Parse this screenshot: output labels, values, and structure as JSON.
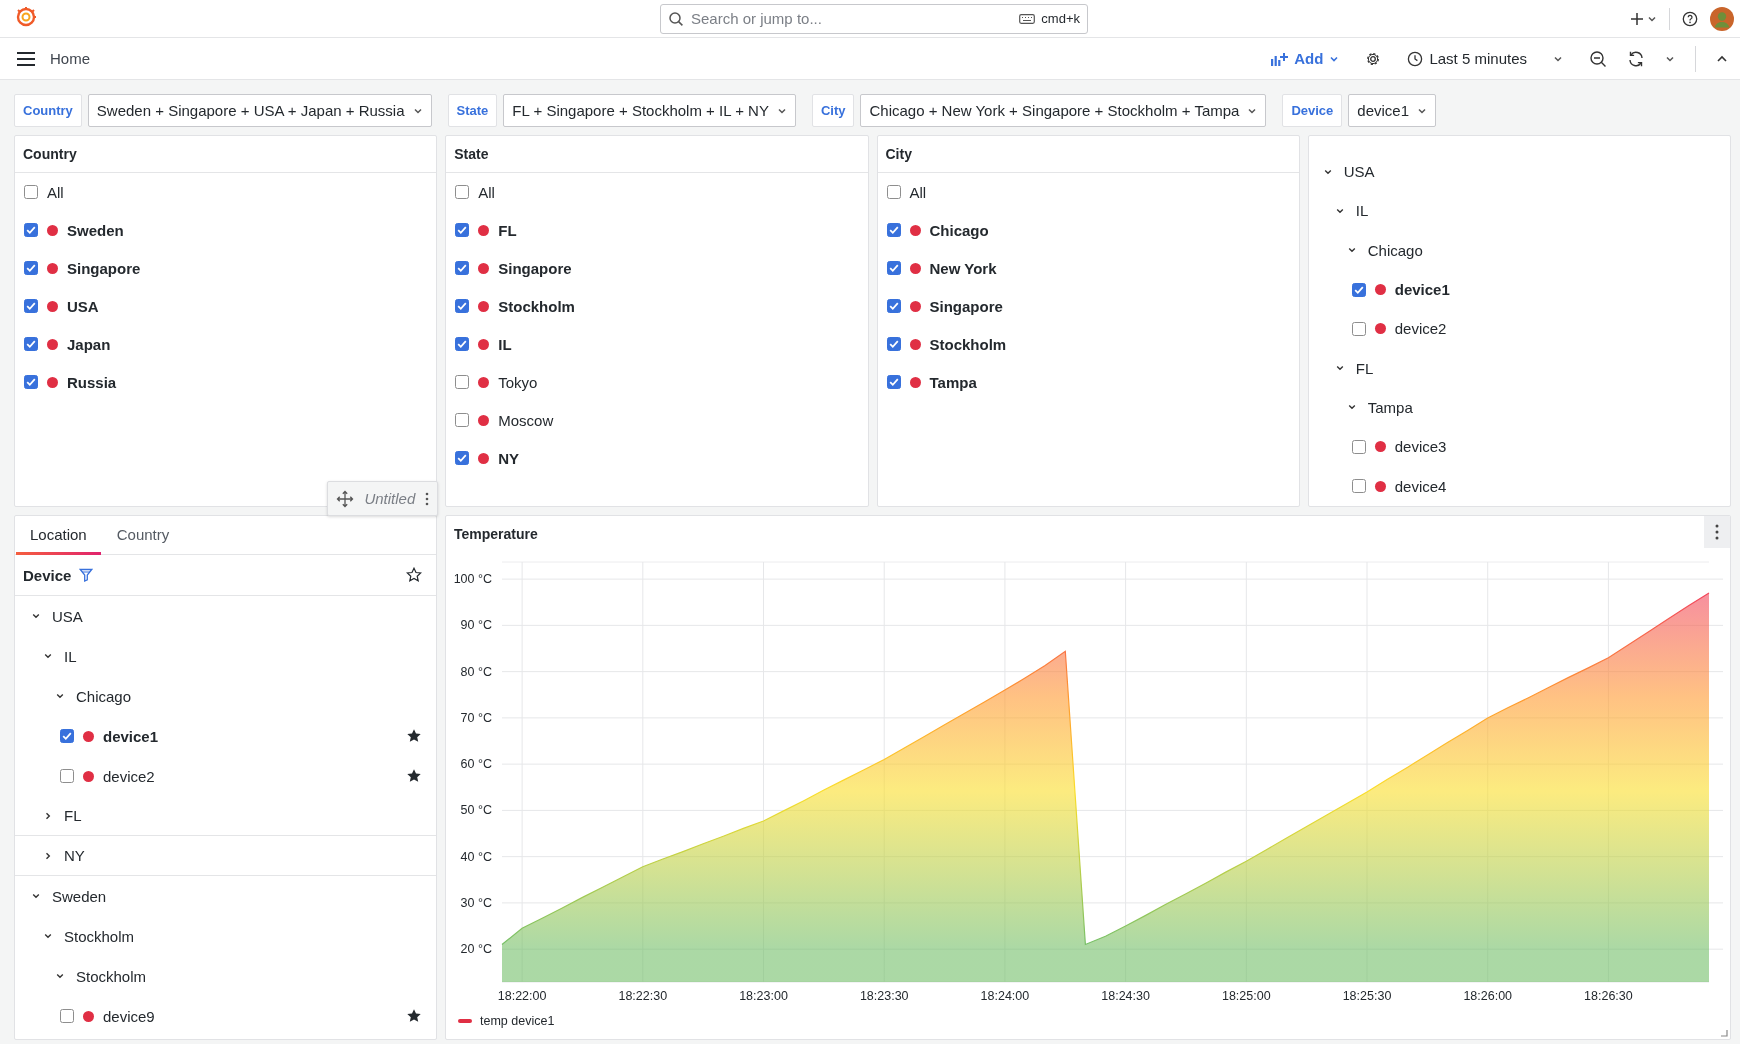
{
  "topbar": {
    "search": {
      "placeholder": "Search or jump to...",
      "shortcut": "cmd+k"
    }
  },
  "toolbar": {
    "breadcrumb": "Home",
    "add_label": "Add",
    "time_range": "Last 5 minutes"
  },
  "variables": [
    {
      "label": "Country",
      "value": "Sweden + Singapore + USA + Japan + Russia"
    },
    {
      "label": "State",
      "value": "FL + Singapore + Stockholm + IL + NY"
    },
    {
      "label": "City",
      "value": "Chicago + New York + Singapore + Stockholm + Tampa"
    },
    {
      "label": "Device",
      "value": "device1"
    }
  ],
  "option_panels": [
    {
      "title": "Country",
      "hover_header": {
        "title": "Untitled"
      },
      "options": [
        {
          "label": "All",
          "kind": "all",
          "checked": false
        },
        {
          "label": "Sweden",
          "kind": "option",
          "checked": true
        },
        {
          "label": "Singapore",
          "kind": "option",
          "checked": true
        },
        {
          "label": "USA",
          "kind": "option",
          "checked": true
        },
        {
          "label": "Japan",
          "kind": "option",
          "checked": true
        },
        {
          "label": "Russia",
          "kind": "option",
          "checked": true
        }
      ]
    },
    {
      "title": "State",
      "options": [
        {
          "label": "All",
          "kind": "all",
          "checked": false
        },
        {
          "label": "FL",
          "kind": "option",
          "checked": true
        },
        {
          "label": "Singapore",
          "kind": "option",
          "checked": true
        },
        {
          "label": "Stockholm",
          "kind": "option",
          "checked": true
        },
        {
          "label": "IL",
          "kind": "option",
          "checked": true
        },
        {
          "label": "Tokyo",
          "kind": "option",
          "checked": false
        },
        {
          "label": "Moscow",
          "kind": "option",
          "checked": false
        },
        {
          "label": "NY",
          "kind": "option",
          "checked": true
        }
      ]
    },
    {
      "title": "City",
      "options": [
        {
          "label": "All",
          "kind": "all",
          "checked": false
        },
        {
          "label": "Chicago",
          "kind": "option",
          "checked": true
        },
        {
          "label": "New York",
          "kind": "option",
          "checked": true
        },
        {
          "label": "Singapore",
          "kind": "option",
          "checked": true
        },
        {
          "label": "Stockholm",
          "kind": "option",
          "checked": true
        },
        {
          "label": "Tampa",
          "kind": "option",
          "checked": true
        }
      ]
    }
  ],
  "tree_panel": {
    "items": [
      {
        "label": "USA",
        "kind": "group",
        "expanded": true,
        "children": [
          {
            "label": "IL",
            "kind": "group",
            "expanded": true,
            "children": [
              {
                "label": "Chicago",
                "kind": "group",
                "expanded": true,
                "children": [
                  {
                    "label": "device1",
                    "kind": "device",
                    "checked": true
                  },
                  {
                    "label": "device2",
                    "kind": "device",
                    "checked": false
                  }
                ]
              }
            ]
          },
          {
            "label": "FL",
            "kind": "group",
            "expanded": true,
            "children": [
              {
                "label": "Tampa",
                "kind": "group",
                "expanded": true,
                "children": [
                  {
                    "label": "device3",
                    "kind": "device",
                    "checked": false
                  },
                  {
                    "label": "device4",
                    "kind": "device",
                    "checked": false
                  }
                ]
              }
            ]
          }
        ]
      }
    ]
  },
  "device_browser": {
    "tabs": [
      {
        "label": "Location",
        "selected": true
      },
      {
        "label": "Country",
        "selected": false
      }
    ],
    "header": {
      "title": "Device",
      "favorites_only": false
    },
    "items": [
      {
        "label": "USA",
        "kind": "group",
        "expanded": true,
        "children": [
          {
            "label": "IL",
            "kind": "group",
            "expanded": true,
            "children": [
              {
                "label": "Chicago",
                "kind": "group",
                "expanded": true,
                "children": [
                  {
                    "label": "device1",
                    "kind": "device",
                    "checked": true,
                    "favorite": true
                  },
                  {
                    "label": "device2",
                    "kind": "device",
                    "checked": false,
                    "favorite": true
                  }
                ]
              }
            ]
          },
          {
            "label": "FL",
            "kind": "group",
            "expanded": false
          },
          {
            "label": "NY",
            "kind": "group",
            "expanded": false
          }
        ]
      },
      {
        "label": "Sweden",
        "kind": "group",
        "expanded": true,
        "children": [
          {
            "label": "Stockholm",
            "kind": "group",
            "expanded": true,
            "children": [
              {
                "label": "Stockholm",
                "kind": "group",
                "expanded": true,
                "children": [
                  {
                    "label": "device9",
                    "kind": "device",
                    "checked": false,
                    "favorite": true
                  }
                ]
              }
            ]
          }
        ]
      }
    ]
  },
  "chart_panel": {
    "title": "Temperature",
    "chart_data": {
      "type": "area",
      "categories": [
        null,
        "18:22:00",
        null,
        null,
        null,
        null,
        null,
        "18:22:30",
        null,
        null,
        null,
        null,
        null,
        "18:23:00",
        null,
        null,
        null,
        null,
        null,
        "18:23:30",
        null,
        null,
        null,
        null,
        null,
        "18:24:00",
        null,
        null,
        null,
        null,
        null,
        "18:24:30",
        null,
        null,
        null,
        null,
        null,
        "18:25:00",
        null,
        null,
        null,
        null,
        null,
        "18:25:30",
        null,
        null,
        null,
        null,
        null,
        "18:26:00",
        null,
        null,
        null,
        null,
        null,
        "18:26:30",
        null,
        null,
        null,
        null,
        null
      ],
      "series": [
        {
          "name": "temp device1",
          "color": "#e02f44",
          "values": [
            21,
            24.5,
            26.7,
            28.9,
            31.2,
            33.4,
            35.6,
            37.8,
            39.5,
            41.1,
            42.8,
            44.4,
            46.1,
            47.7,
            49.9,
            52.1,
            54.4,
            56.6,
            58.8,
            61,
            63.5,
            66,
            68.5,
            71,
            73.5,
            76,
            78.6,
            81.3,
            84.4,
            21,
            22.8,
            25,
            27.3,
            29.7,
            32,
            34.3,
            36.7,
            39,
            41.5,
            44,
            46.5,
            49,
            51.5,
            54,
            56.7,
            59.3,
            62,
            64.7,
            67.3,
            70,
            72.2,
            74.3,
            76.5,
            78.7,
            80.8,
            83,
            85.8,
            88.6,
            91.5,
            94.3,
            97
          ]
        }
      ],
      "ylim": [
        12.9,
        103.7
      ],
      "grid": true,
      "yticks": [
        {
          "value": 20,
          "label": "20 °C"
        },
        {
          "value": 30,
          "label": "30 °C"
        },
        {
          "value": 40,
          "label": "40 °C"
        },
        {
          "value": 50,
          "label": "50 °C"
        },
        {
          "value": 60,
          "label": "60 °C"
        },
        {
          "value": 70,
          "label": "70 °C"
        },
        {
          "value": 80,
          "label": "80 °C"
        },
        {
          "value": 90,
          "label": "90 °C"
        },
        {
          "value": 100,
          "label": "100 °C"
        }
      ]
    }
  }
}
